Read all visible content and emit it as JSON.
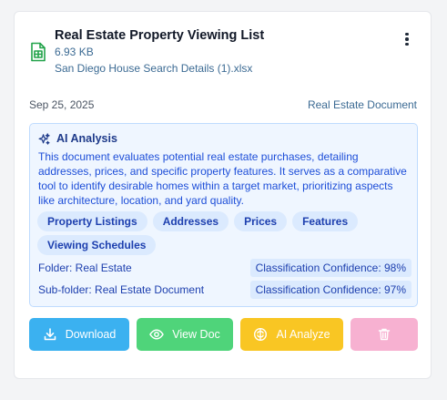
{
  "document": {
    "title": "Real Estate Property Viewing List",
    "size": "6.93 KB",
    "filename": "San Diego House Search Details (1).xlsx",
    "date": "Sep 25, 2025",
    "category": "Real Estate Document",
    "file_icon": "spreadsheet-file-icon",
    "menu_icon": "more-vertical-icon"
  },
  "ai_analysis": {
    "title": "AI Analysis",
    "icon": "sparkles-icon",
    "description": "This document evaluates potential real estate purchases, detailing addresses, prices, and specific property features. It serves as a comparative tool to identify desirable homes within a target market, prioritizing aspects like architecture, location, and yard quality.",
    "tags": [
      "Property Listings",
      "Addresses",
      "Prices",
      "Features",
      "Viewing Schedules"
    ],
    "folder": "Folder: Real Estate",
    "subfolder": "Sub-folder: Real Estate Document",
    "folder_confidence": "Classification Confidence: 98%",
    "subfolder_confidence": "Classification Confidence: 97%"
  },
  "actions": {
    "download": "Download",
    "view": "View Doc",
    "ai_analyze": "AI Analyze",
    "delete_icon": "trash-icon"
  },
  "colors": {
    "download": "#3bb1f0",
    "view": "#4fd47a",
    "ai_analyze": "#f9c623",
    "delete": "#f7b1d1",
    "accent": "#1e40af"
  }
}
